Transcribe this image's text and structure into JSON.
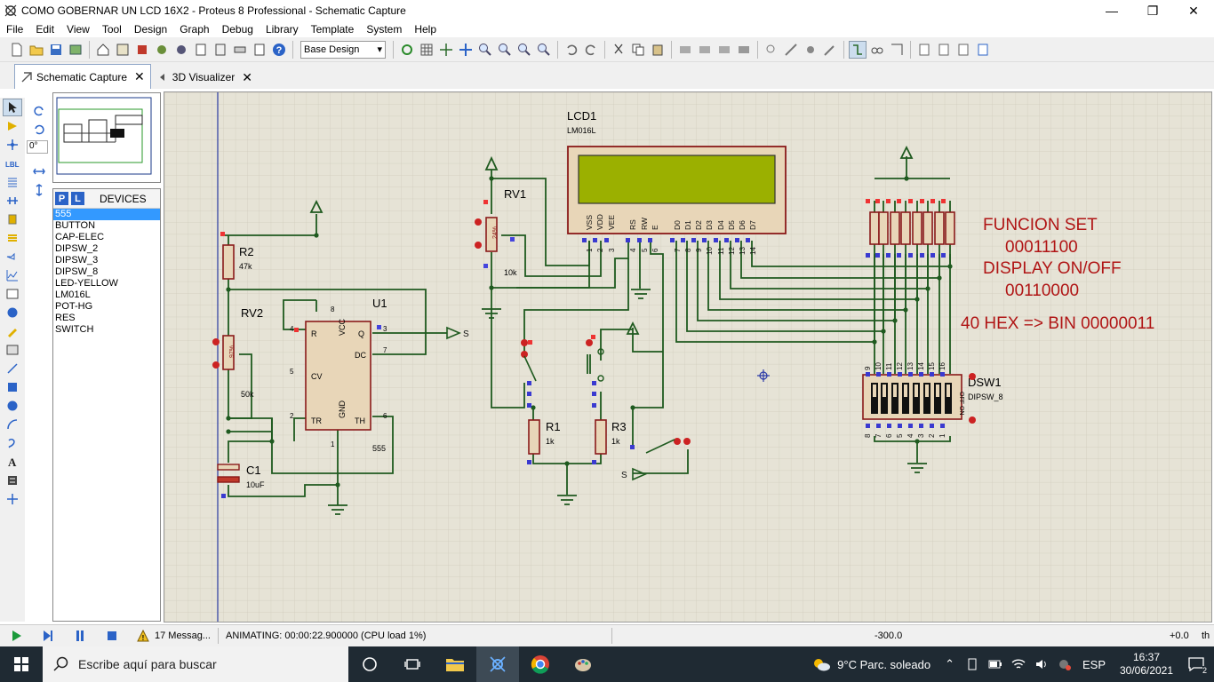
{
  "window": {
    "title": "COMO GOBERNAR UN LCD 16X2 - Proteus 8 Professional - Schematic Capture"
  },
  "menu": [
    "File",
    "Edit",
    "View",
    "Tool",
    "Design",
    "Graph",
    "Debug",
    "Library",
    "Template",
    "System",
    "Help"
  ],
  "toolbar": {
    "design_select": "Base Design"
  },
  "tabs": [
    {
      "label": "Schematic Capture",
      "active": true
    },
    {
      "label": "3D Visualizer",
      "active": false
    }
  ],
  "left_panel": {
    "rotation": "0°",
    "p_button": "P",
    "l_button": "L",
    "devices_title": "DEVICES",
    "devices": [
      "555",
      "BUTTON",
      "CAP-ELEC",
      "DIPSW_2",
      "DIPSW_3",
      "DIPSW_8",
      "LED-YELLOW",
      "LM016L",
      "POT-HG",
      "RES",
      "SWITCH"
    ],
    "selected_device": "555"
  },
  "schematic": {
    "lcd_ref": "LCD1",
    "lcd_part": "LM016L",
    "lcd_pins": [
      "VSS",
      "VDD",
      "VEE",
      "RS",
      "RW",
      "E",
      "D0",
      "D1",
      "D2",
      "D3",
      "D4",
      "D5",
      "D6",
      "D7"
    ],
    "lcd_pin_nums": [
      "1",
      "2",
      "3",
      "4",
      "5",
      "6",
      "7",
      "8",
      "9",
      "10",
      "11",
      "12",
      "13",
      "14"
    ],
    "rv1": "RV1",
    "rv1_val": "10k",
    "rv1_pct": "24%",
    "r2": "R2",
    "r2_val": "47k",
    "rv2": "RV2",
    "rv2_val": "50k",
    "rv2_pct": "97%",
    "c1": "C1",
    "c1_val": "10uF",
    "u1": "U1",
    "u1_part": "555",
    "u1_pins": {
      "R": "R",
      "VCC": "VCC",
      "Q": "Q",
      "DC": "DC",
      "CV": "CV",
      "TR": "TR",
      "GND": "GND",
      "TH": "TH"
    },
    "u1_pin_nums": {
      "p4": "4",
      "p8": "8",
      "p3": "3",
      "p7": "7",
      "p5": "5",
      "p2": "2",
      "p1": "1",
      "p6": "6"
    },
    "net_s": "S",
    "r1": "R1",
    "r1_val": "1k",
    "r3": "R3",
    "r3_val": "1k",
    "dsw1": "DSW1",
    "dsw1_part": "DIPSW_8",
    "dsw_top_nums": [
      "9",
      "10",
      "11",
      "12",
      "13",
      "14",
      "15",
      "16"
    ],
    "dsw_bot_nums": [
      "8",
      "7",
      "6",
      "5",
      "4",
      "3",
      "2",
      "1"
    ],
    "dsw_on": "ON",
    "dsw_off": "OFF",
    "note_line1": "FUNCION SET",
    "note_line2": "00011100",
    "note_line3": "DISPLAY  ON/OFF",
    "note_line4": "00110000",
    "note_line5": "40 HEX => BIN 00000011"
  },
  "status": {
    "messages": "17 Messag...",
    "animating": "ANIMATING: 00:00:22.900000 (CPU load 1%)",
    "coord_x": "-300.0",
    "coord_y": "+0.0",
    "unit": "th"
  },
  "taskbar": {
    "search_placeholder": "Escribe aquí para buscar",
    "weather": "9°C  Parc. soleado",
    "lang": "ESP",
    "time": "16:37",
    "date": "30/06/2021",
    "notifications": "2"
  }
}
